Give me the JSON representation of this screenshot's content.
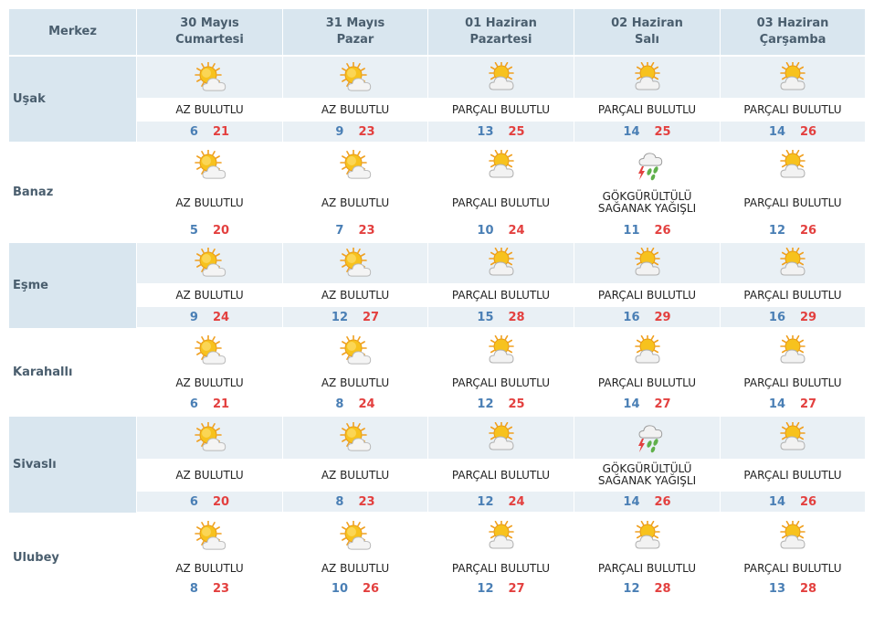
{
  "header": {
    "station_label": "Merkez",
    "days": [
      {
        "date": "30 Mayıs",
        "weekday": "Cumartesi"
      },
      {
        "date": "31 Mayıs",
        "weekday": "Pazar"
      },
      {
        "date": "01 Haziran",
        "weekday": "Pazartesi"
      },
      {
        "date": "02 Haziran",
        "weekday": "Salı"
      },
      {
        "date": "03 Haziran",
        "weekday": "Çarşamba"
      }
    ]
  },
  "colors": {
    "header_bg": "#d9e6ef",
    "shaded_row_bg": "#e9f0f5",
    "label_text": "#4a5e6e",
    "min_temp": "#4a7fb5",
    "max_temp": "#e3403f"
  },
  "stations": [
    {
      "name": "Uşak",
      "shaded": true,
      "days": [
        {
          "icon": "sun-cloud-icon",
          "condition": "AZ BULUTLU",
          "min": "6",
          "max": "21"
        },
        {
          "icon": "sun-cloud-icon",
          "condition": "AZ BULUTLU",
          "min": "9",
          "max": "23"
        },
        {
          "icon": "partly-cloudy-icon",
          "condition": "PARÇALI BULUTLU",
          "min": "13",
          "max": "25"
        },
        {
          "icon": "partly-cloudy-icon",
          "condition": "PARÇALI BULUTLU",
          "min": "14",
          "max": "25"
        },
        {
          "icon": "partly-cloudy-icon",
          "condition": "PARÇALI BULUTLU",
          "min": "14",
          "max": "26"
        }
      ]
    },
    {
      "name": "Banaz",
      "shaded": false,
      "days": [
        {
          "icon": "sun-cloud-icon",
          "condition": "AZ BULUTLU",
          "min": "5",
          "max": "20"
        },
        {
          "icon": "sun-cloud-icon",
          "condition": "AZ BULUTLU",
          "min": "7",
          "max": "23"
        },
        {
          "icon": "partly-cloudy-icon",
          "condition": "PARÇALI BULUTLU",
          "min": "10",
          "max": "24"
        },
        {
          "icon": "thunderstorm-rain-icon",
          "condition": "GÖKGÜRÜLTÜLÜ SAĞANAK YAĞIŞLI",
          "min": "11",
          "max": "26"
        },
        {
          "icon": "partly-cloudy-icon",
          "condition": "PARÇALI BULUTLU",
          "min": "12",
          "max": "26"
        }
      ]
    },
    {
      "name": "Eşme",
      "shaded": true,
      "days": [
        {
          "icon": "sun-cloud-icon",
          "condition": "AZ BULUTLU",
          "min": "9",
          "max": "24"
        },
        {
          "icon": "sun-cloud-icon",
          "condition": "AZ BULUTLU",
          "min": "12",
          "max": "27"
        },
        {
          "icon": "partly-cloudy-icon",
          "condition": "PARÇALI BULUTLU",
          "min": "15",
          "max": "28"
        },
        {
          "icon": "partly-cloudy-icon",
          "condition": "PARÇALI BULUTLU",
          "min": "16",
          "max": "29"
        },
        {
          "icon": "partly-cloudy-icon",
          "condition": "PARÇALI BULUTLU",
          "min": "16",
          "max": "29"
        }
      ]
    },
    {
      "name": "Karahallı",
      "shaded": false,
      "days": [
        {
          "icon": "sun-cloud-icon",
          "condition": "AZ BULUTLU",
          "min": "6",
          "max": "21"
        },
        {
          "icon": "sun-cloud-icon",
          "condition": "AZ BULUTLU",
          "min": "8",
          "max": "24"
        },
        {
          "icon": "partly-cloudy-icon",
          "condition": "PARÇALI BULUTLU",
          "min": "12",
          "max": "25"
        },
        {
          "icon": "partly-cloudy-icon",
          "condition": "PARÇALI BULUTLU",
          "min": "14",
          "max": "27"
        },
        {
          "icon": "partly-cloudy-icon",
          "condition": "PARÇALI BULUTLU",
          "min": "14",
          "max": "27"
        }
      ]
    },
    {
      "name": "Sivaslı",
      "shaded": true,
      "days": [
        {
          "icon": "sun-cloud-icon",
          "condition": "AZ BULUTLU",
          "min": "6",
          "max": "20"
        },
        {
          "icon": "sun-cloud-icon",
          "condition": "AZ BULUTLU",
          "min": "8",
          "max": "23"
        },
        {
          "icon": "partly-cloudy-icon",
          "condition": "PARÇALI BULUTLU",
          "min": "12",
          "max": "24"
        },
        {
          "icon": "thunderstorm-rain-icon",
          "condition": "GÖKGÜRÜLTÜLÜ SAĞANAK YAĞIŞLI",
          "min": "14",
          "max": "26"
        },
        {
          "icon": "partly-cloudy-icon",
          "condition": "PARÇALI BULUTLU",
          "min": "14",
          "max": "26"
        }
      ]
    },
    {
      "name": "Ulubey",
      "shaded": false,
      "days": [
        {
          "icon": "sun-cloud-icon",
          "condition": "AZ BULUTLU",
          "min": "8",
          "max": "23"
        },
        {
          "icon": "sun-cloud-icon",
          "condition": "AZ BULUTLU",
          "min": "10",
          "max": "26"
        },
        {
          "icon": "partly-cloudy-icon",
          "condition": "PARÇALI BULUTLU",
          "min": "12",
          "max": "27"
        },
        {
          "icon": "partly-cloudy-icon",
          "condition": "PARÇALI BULUTLU",
          "min": "12",
          "max": "28"
        },
        {
          "icon": "partly-cloudy-icon",
          "condition": "PARÇALI BULUTLU",
          "min": "13",
          "max": "28"
        }
      ]
    }
  ]
}
